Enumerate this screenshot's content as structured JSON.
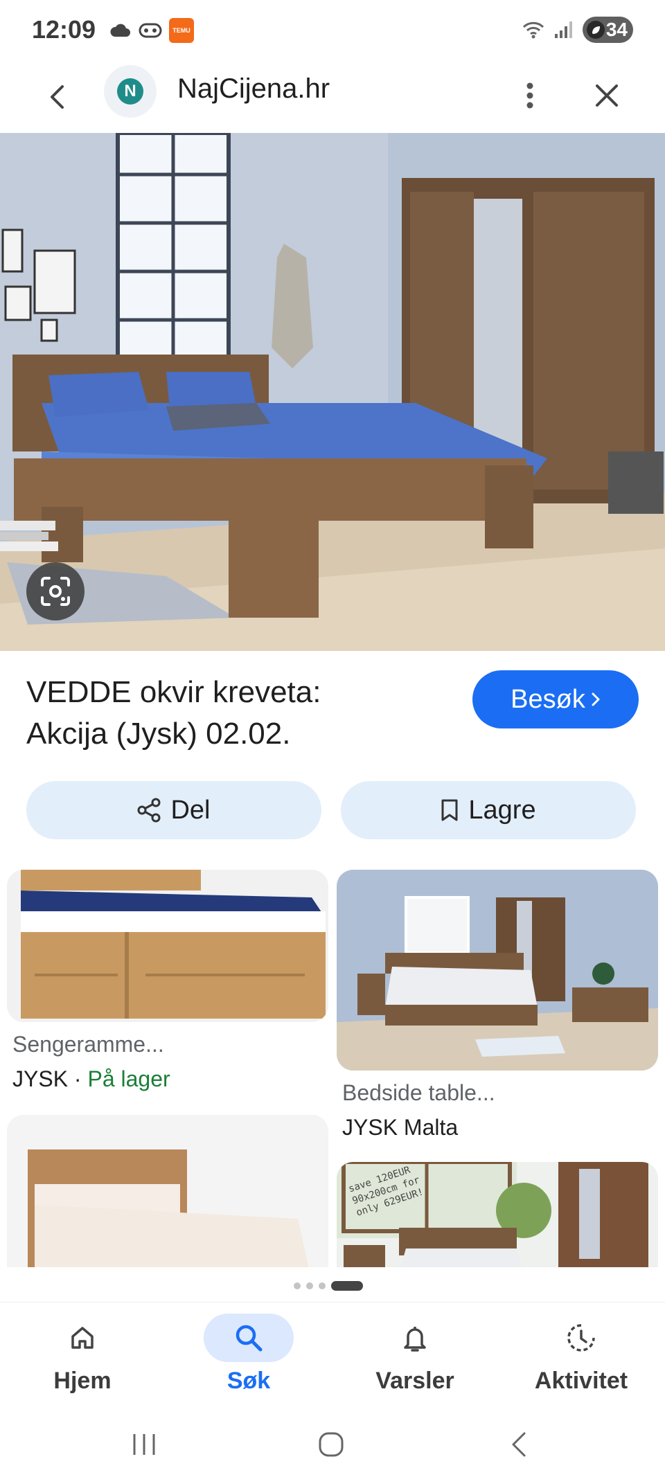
{
  "status_bar": {
    "time": "12:09",
    "temu_label": "TEMU",
    "battery": "34"
  },
  "header": {
    "site_initial": "N",
    "site_name": "NajCijena.hr"
  },
  "product": {
    "title_line1": "VEDDE okvir kreveta:",
    "title_line2": "Akcija (Jysk) 02.02.",
    "visit_label": "Besøk"
  },
  "actions": {
    "share_label": "Del",
    "save_label": "Lagre"
  },
  "related": [
    {
      "title": "Sengeramme...",
      "source": "JYSK",
      "separator": " · ",
      "stock": "På lager"
    },
    {
      "title": "Bedside table...",
      "source": "JYSK Malta"
    },
    {
      "title": "",
      "source": ""
    },
    {
      "title": "",
      "source": "",
      "overlay_text": "save 120EUR 90x200cm for only 629EUR!"
    }
  ],
  "bottom_nav": {
    "items": [
      {
        "label": "Hjem",
        "icon": "home-icon"
      },
      {
        "label": "Søk",
        "icon": "search-icon",
        "active": true
      },
      {
        "label": "Varsler",
        "icon": "bell-icon"
      },
      {
        "label": "Aktivitet",
        "icon": "activity-icon"
      }
    ]
  },
  "colors": {
    "accent": "#1b6ef3",
    "chip_bg": "#e3eefb",
    "in_stock": "#1a7f37"
  }
}
